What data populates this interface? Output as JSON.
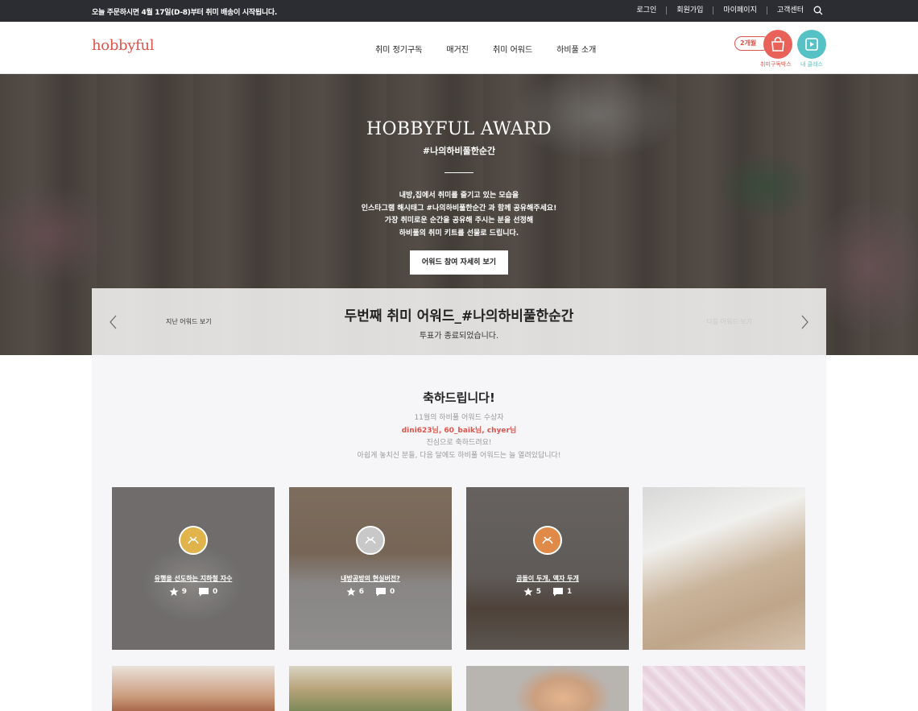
{
  "topbar": {
    "notice": "오늘 주문하시면 4월 17일(D-8)부터 취미 배송이 시작됩니다.",
    "links": [
      "로그인",
      "회원가입",
      "마이페이지",
      "고객센터"
    ]
  },
  "header": {
    "logo": "hobbyful",
    "nav": [
      "취미 정기구독",
      "매거진",
      "취미 어워드",
      "하비풀 소개"
    ],
    "subscription_badge": "2개월",
    "subscription_label": "취미구독박스",
    "class_label": "내 클래스"
  },
  "hero": {
    "title": "HOBBYFUL AWARD",
    "hashtag": "#나의하비풀한순간",
    "description": [
      "내방,집에서 취미를 즐기고 있는 모습을",
      "인스타그램 해시태그 #나의하비풀한순간 과 함께 공유해주세요!",
      "가장 취미로운 순간을 공유해 주시는 분을 선정해",
      "하비풀의 취미 키트를 선물로 드립니다."
    ],
    "cta": "어워드 참여 자세히 보기"
  },
  "award_bar": {
    "title": "두번째 취미 어워드_#나의하비풀한순간",
    "status": "투표가 종료되었습니다.",
    "prev_label": "지난 어워드 보기",
    "next_label": "다음 어워드 보기"
  },
  "congrats": {
    "heading": "축하드립니다!",
    "line1": "11월의 하비풀 어워드 수상자",
    "winners": "dini623님, 60_baik님, chyer님",
    "line3": "진심으로 축하드려요!",
    "line4": "아쉽게 놓치신 분들, 다음 달에도 하비풀 어워드는 늘 열려있답니다!"
  },
  "cards": [
    {
      "caption": "유행을 선도하는 지하철 자수",
      "stars": "9",
      "comments": "0",
      "badge_color": "#e0b44a"
    },
    {
      "caption": "내방공방의 현실버전?",
      "stars": "6",
      "comments": "0",
      "badge_color": "#c8c8c8"
    },
    {
      "caption": "곰돌이 두개, 액자 두개",
      "stars": "5",
      "comments": "1",
      "badge_color": "#e08a4a"
    }
  ],
  "colors": {
    "accent": "#e0534a",
    "teal": "#56c2c6",
    "topbar": "#2b2d33"
  }
}
